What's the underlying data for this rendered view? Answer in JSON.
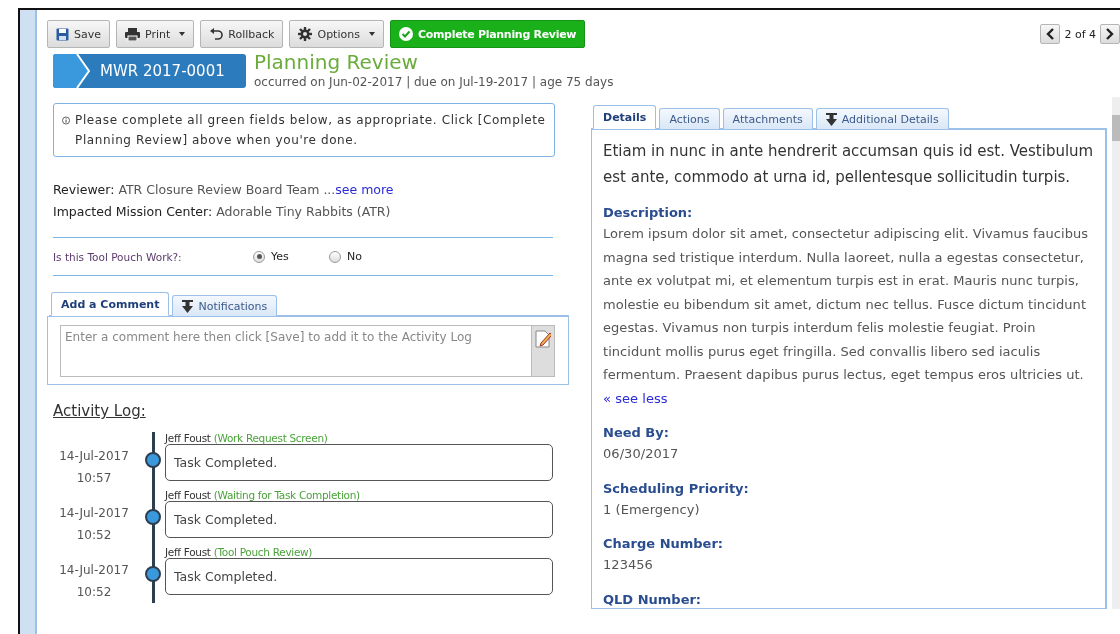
{
  "toolbar": {
    "buttons": [
      {
        "label": "Save",
        "kind": "save",
        "dropdown": false
      },
      {
        "label": "Print",
        "kind": "print",
        "dropdown": true
      },
      {
        "label": "Rollback",
        "kind": "rollback",
        "dropdown": false
      },
      {
        "label": "Options",
        "kind": "options",
        "dropdown": true
      },
      {
        "label": "Complete Planning Review",
        "kind": "complete",
        "dropdown": false
      }
    ],
    "pager": "2 of 4"
  },
  "record": {
    "id": "MWR 2017-0001",
    "step": "Planning Review",
    "meta": "occurred on Jun-02-2017 | due on Jul-19-2017 | age 75 days"
  },
  "notice": "Please complete all green fields below, as appropriate. Click [Complete Planning Review] above when you're done.",
  "reviewer": {
    "label": "Reviewer:",
    "value": "ATR Closure Review Board Team ...",
    "link": "see more"
  },
  "mission_center": {
    "label": "Impacted Mission Center:",
    "value": "Adorable Tiny Rabbits (ATR)"
  },
  "tool_pouch": {
    "question": "Is this Tool Pouch Work?:",
    "options": [
      {
        "label": "Yes",
        "selected": true
      },
      {
        "label": "No",
        "selected": false
      }
    ]
  },
  "comment_tabs": [
    {
      "label": "Add a Comment",
      "selected": true,
      "kind": "plain"
    },
    {
      "label": "Notifications",
      "selected": false,
      "kind": "download"
    }
  ],
  "comment": {
    "placeholder": "Enter a comment here then click [Save] to add it to the Activity Log"
  },
  "activity_log": {
    "title": "Activity Log:",
    "entries": [
      {
        "date": "14-Jul-2017",
        "time": "10:57",
        "user": "Jeff Foust",
        "step": "(Work Request Screen)",
        "text": "Task Completed."
      },
      {
        "date": "14-Jul-2017",
        "time": "10:52",
        "user": "Jeff Foust",
        "step": "(Waiting for Task Completion)",
        "text": "Task Completed."
      },
      {
        "date": "14-Jul-2017",
        "time": "10:52",
        "user": "Jeff Foust",
        "step": "(Tool Pouch Review)",
        "text": "Task Completed."
      }
    ]
  },
  "detail_tabs": [
    {
      "label": "Details",
      "selected": true,
      "kind": "plain"
    },
    {
      "label": "Actions",
      "selected": false,
      "kind": "plain"
    },
    {
      "label": "Attachments",
      "selected": false,
      "kind": "plain"
    },
    {
      "label": "Additional Details",
      "selected": false,
      "kind": "download"
    }
  ],
  "details": {
    "summary": "Etiam in nunc in ante hendrerit accumsan quis id est. Vestibulum est ante, commodo at urna id, pellentesque sollicitudin turpis.",
    "fields": [
      {
        "label": "Description:",
        "value": "Lorem ipsum dolor sit amet, consectetur adipiscing elit. Vivamus faucibus magna sed tristique interdum. Nulla laoreet, nulla a egestas consectetur, ante ex volutpat mi, et elementum turpis est in erat. Mauris nunc turpis, molestie eu bibendum sit amet, dictum nec tellus. Fusce dictum tincidunt egestas. Vivamus non turpis interdum felis molestie feugiat. Proin tincidunt mollis purus eget fringilla. Sed convallis libero sed iaculis fermentum. Praesent dapibus purus lectus, eget tempus eros ultricies ut.",
        "link": "« see less"
      },
      {
        "label": "Need By:",
        "value": "06/30/2017"
      },
      {
        "label": "Scheduling Priority:",
        "value": "1 (Emergency)"
      },
      {
        "label": "Charge Number:",
        "value": "123456"
      },
      {
        "label": "QLD Number:"
      }
    ]
  }
}
